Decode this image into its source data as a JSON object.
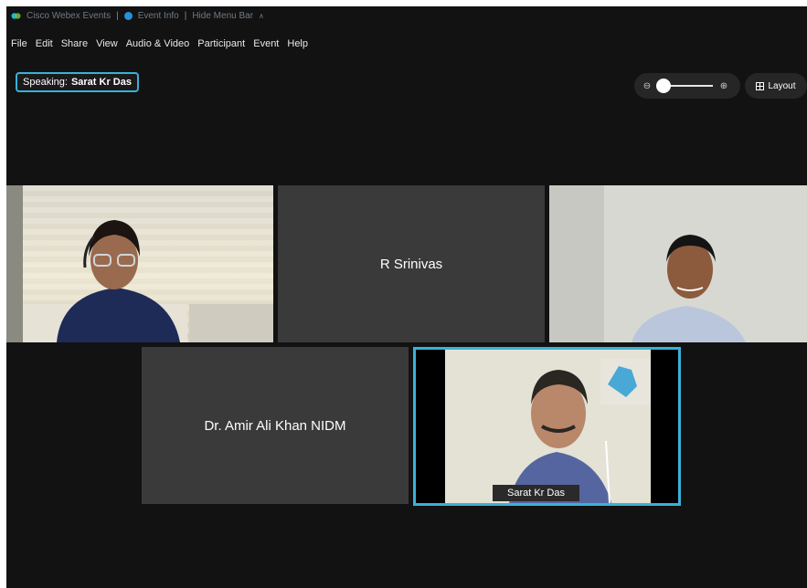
{
  "titlebar": {
    "app_name": "Cisco Webex Events",
    "separator": "|",
    "event_info": "Event Info",
    "separator2": "|",
    "hide_menu": "Hide Menu Bar"
  },
  "menu": {
    "file": "File",
    "edit": "Edit",
    "share": "Share",
    "view": "View",
    "audio_video": "Audio & Video",
    "participant": "Participant",
    "event": "Event",
    "help": "Help"
  },
  "speaking": {
    "prefix": "Speaking:",
    "name": "Sarat Kr Das"
  },
  "controls": {
    "layout_label": "Layout",
    "zoom_level": 0
  },
  "tiles": {
    "t2_name": "R Srinivas",
    "t4_name": "Dr. Amir Ali Khan NIDM",
    "t5_label": "Sarat Kr Das"
  },
  "colors": {
    "accent": "#3ab1d8",
    "background": "#121212",
    "tile": "#3a3a3a"
  }
}
